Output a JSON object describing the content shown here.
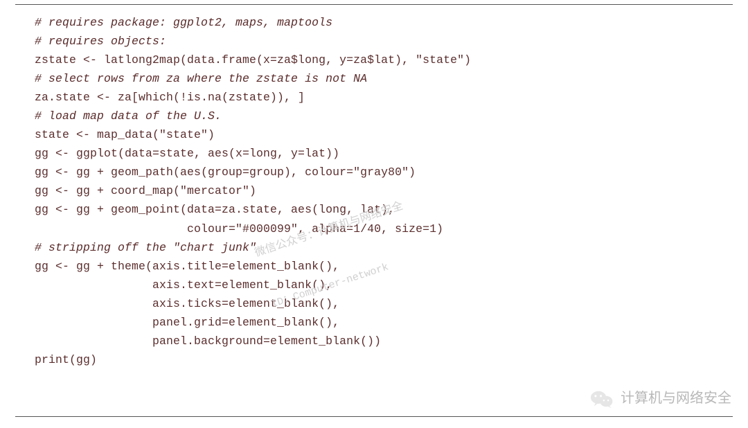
{
  "code": {
    "l01": "# requires package: ggplot2, maps, maptools",
    "l02": "# requires objects:",
    "l03": "zstate <- latlong2map(data.frame(x=za$long, y=za$lat), \"state\")",
    "l04": "# select rows from za where the zstate is not NA",
    "l05": "za.state <- za[which(!is.na(zstate)), ]",
    "l06": "# load map data of the U.S.",
    "l07": "state <- map_data(\"state\")",
    "l08": "",
    "l09": "gg <- ggplot(data=state, aes(x=long, y=lat))",
    "l10": "gg <- gg + geom_path(aes(group=group), colour=\"gray80\")",
    "l11": "gg <- gg + coord_map(\"mercator\")",
    "l12": "gg <- gg + geom_point(data=za.state, aes(long, lat),",
    "l13": "                      colour=\"#000099\", alpha=1/40, size=1)",
    "l14": "# stripping off the \"chart junk\"",
    "l15": "gg <- gg + theme(axis.title=element_blank(),",
    "l16": "                 axis.text=element_blank(),",
    "l17": "                 axis.ticks=element_blank(),",
    "l18": "                 panel.grid=element_blank(),",
    "l19": "                 panel.background=element_blank())",
    "l20": "print(gg)"
  },
  "watermark": {
    "center_line1": "微信公众号：计算机与网络安全",
    "center_line2": "ID：Computer-network",
    "bottom_right": "计算机与网络安全"
  }
}
